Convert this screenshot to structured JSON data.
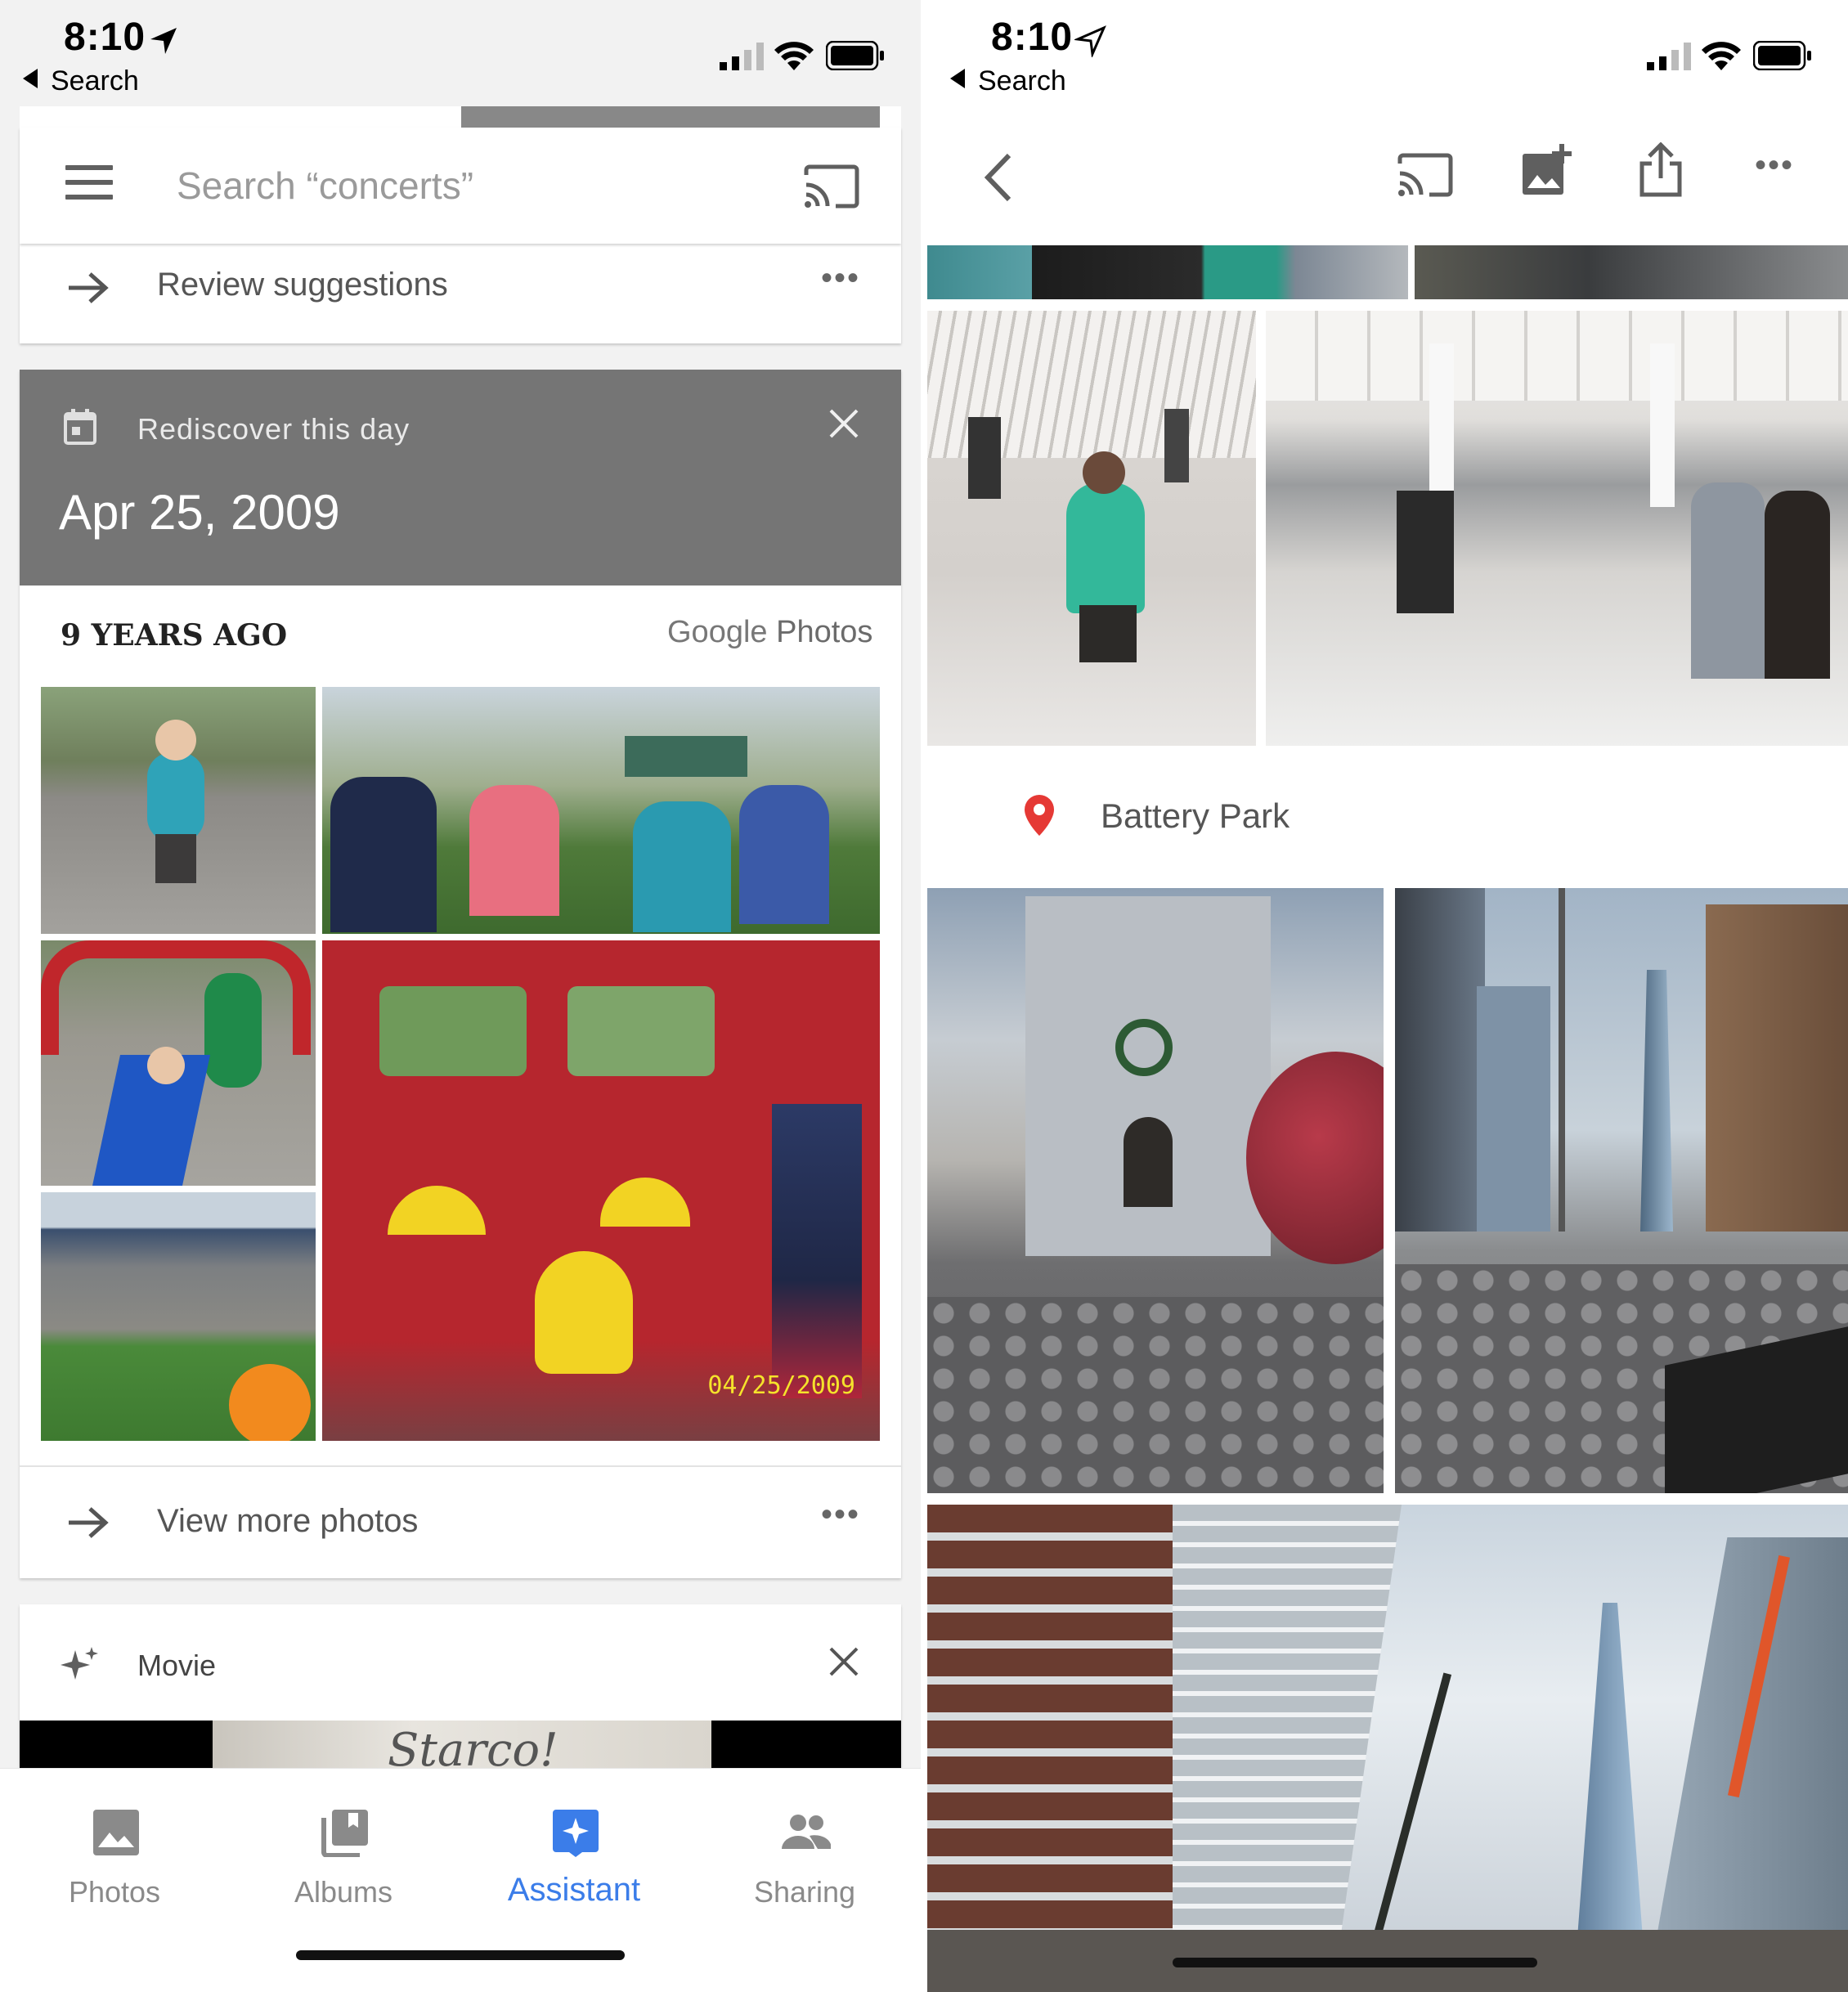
{
  "left_screen": {
    "status_bar": {
      "time": "8:10",
      "back_label": "Search"
    },
    "search": {
      "placeholder": "Search “concerts”",
      "menu_icon": "hamburger-icon",
      "cast_icon": "cast-icon"
    },
    "review_card": {
      "label": "Review suggestions"
    },
    "rediscover_card": {
      "kicker": "Rediscover this day",
      "date": "Apr 25, 2009",
      "years_ago": "9 YEARS AGO",
      "brand_google": "Google",
      "brand_photos": "Photos",
      "photo_stamp": "04/25/2009",
      "view_more": "View more photos",
      "header_color": "#757575"
    },
    "movie_card": {
      "label": "Movie",
      "preview_text": "Starco!"
    },
    "bottom_nav": {
      "items": [
        {
          "label": "Photos",
          "icon": "photo-icon",
          "active": false
        },
        {
          "label": "Albums",
          "icon": "albums-icon",
          "active": false
        },
        {
          "label": "Assistant",
          "icon": "assistant-icon",
          "active": true
        },
        {
          "label": "Sharing",
          "icon": "people-icon",
          "active": false
        }
      ],
      "active_color": "#3b7de9"
    }
  },
  "right_screen": {
    "status_bar": {
      "time": "8:10",
      "back_label": "Search"
    },
    "toolbar": {
      "icons": [
        "back-icon",
        "cast-icon",
        "add-to-album-icon",
        "share-icon",
        "more-icon"
      ]
    },
    "location": {
      "label": "Battery Park",
      "pin_color": "#e53935"
    }
  }
}
